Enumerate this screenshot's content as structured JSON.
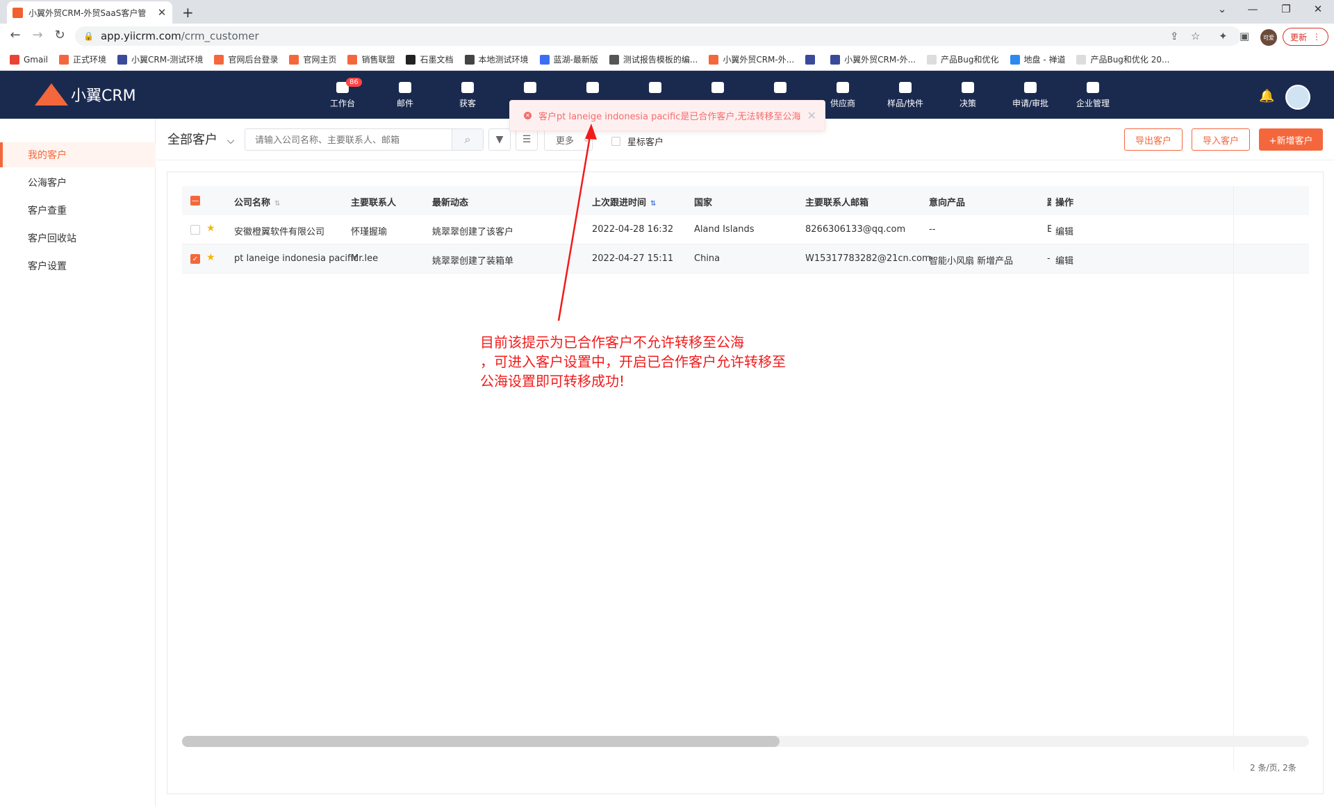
{
  "browser": {
    "tab_title": "小翼外贸CRM-外贸SaaS客户管",
    "url_host": "app.yiicrm.com",
    "url_path": "/crm_customer",
    "profile_label": "可爱",
    "update_label": "更新",
    "bookmarks": [
      {
        "label": "Gmail",
        "color": "#ea4335"
      },
      {
        "label": "正式环境",
        "color": "#f4673c"
      },
      {
        "label": "小翼CRM-测试环境",
        "color": "#3a4a9b"
      },
      {
        "label": "官网后台登录",
        "color": "#f4673c"
      },
      {
        "label": "官网主页",
        "color": "#f4673c"
      },
      {
        "label": "销售联盟",
        "color": "#f4673c"
      },
      {
        "label": "石墨文档",
        "color": "#222222"
      },
      {
        "label": "本地测试环境",
        "color": "#444444"
      },
      {
        "label": "蓝湖-最新版",
        "color": "#3b6ef5"
      },
      {
        "label": "测试报告模板的编...",
        "color": "#555555"
      },
      {
        "label": "小翼外贸CRM-外...",
        "color": "#f4673c"
      },
      {
        "label": "",
        "color": "#3a4a9b"
      },
      {
        "label": "小翼外贸CRM-外...",
        "color": "#3a4a9b"
      },
      {
        "label": "产品Bug和优化",
        "color": "#dddddd"
      },
      {
        "label": "地盘 - 禅道",
        "color": "#2a8af0"
      },
      {
        "label": "产品Bug和优化 20...",
        "color": "#dddddd"
      }
    ]
  },
  "app": {
    "logo_text": "小翼CRM",
    "nav": [
      {
        "label": "工作台",
        "badge": "86"
      },
      {
        "label": "邮件"
      },
      {
        "label": "获客"
      },
      {
        "label": ""
      },
      {
        "label": ""
      },
      {
        "label": ""
      },
      {
        "label": ""
      },
      {
        "label": ""
      },
      {
        "label": "供应商"
      },
      {
        "label": "样品/快件"
      },
      {
        "label": "决策"
      },
      {
        "label": "申请/审批"
      },
      {
        "label": "企业管理"
      }
    ],
    "accent_color": "#f4673c"
  },
  "toast": {
    "message": "客户pt laneige indonesia pacific是已合作客户,无法转移至公海"
  },
  "sidebar": {
    "items": [
      {
        "label": "我的客户",
        "active": true
      },
      {
        "label": "公海客户"
      },
      {
        "label": "客户查重"
      },
      {
        "label": "客户回收站"
      },
      {
        "label": "客户设置"
      }
    ]
  },
  "filter": {
    "scope": "全部客户",
    "search_placeholder": "请输入公司名称、主要联系人、邮箱",
    "more_label": "更多",
    "star_label": "星标客户",
    "export_label": "导出客户",
    "import_label": "导入客户",
    "new_label": "+新增客户"
  },
  "table": {
    "headers": {
      "company": "公司名称",
      "contact": "主要联系人",
      "activity": "最新动态",
      "last_follow": "上次跟进时间",
      "country": "国家",
      "email": "主要联系人邮箱",
      "product": "意向产品",
      "col_cut": "跟",
      "action": "操作"
    },
    "rows": [
      {
        "checked": false,
        "company": "安徽橙翼软件有限公司",
        "contact": "怀瑾握瑜",
        "activity": "姚翠翠创建了该客户",
        "last_follow": "2022-04-28 16:32",
        "country": "Aland Islands",
        "email": "8266306133@qq.com",
        "product": "--",
        "col_cut": "E",
        "action": "编辑"
      },
      {
        "checked": true,
        "company": "pt laneige indonesia pacific",
        "contact": "Mr.lee",
        "activity": "姚翠翠创建了装箱单",
        "last_follow": "2022-04-27 15:11",
        "country": "China",
        "email": "W15317783282@21cn.com",
        "product": "智能小风扇 新增产品",
        "col_cut": "-",
        "action": "编辑"
      }
    ],
    "pager": "2 条/页,  2条",
    "scroll_fraction": 0.53
  },
  "annotation": {
    "line1": "目前该提示为已合作客户不允许转移至公海",
    "line2": "，可进入客户设置中，开启已合作客户允许转移至",
    "line3": "公海设置即可转移成功!",
    "color": "#f21a1a"
  }
}
